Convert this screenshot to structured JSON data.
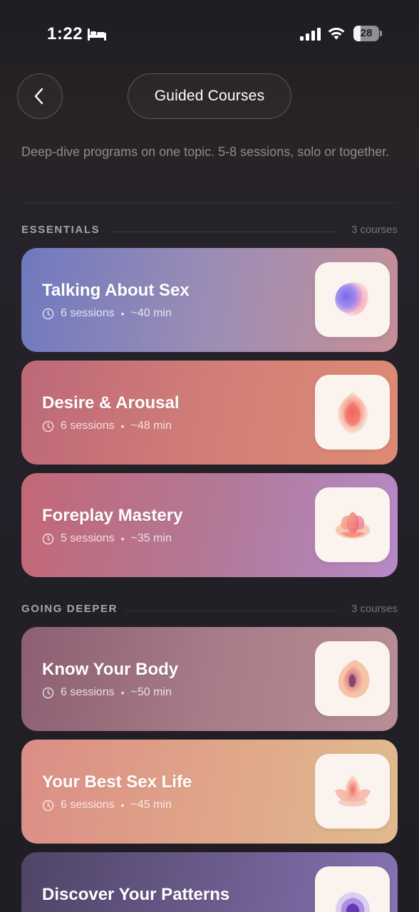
{
  "status_bar": {
    "time": "1:22",
    "battery": "28",
    "battery_level": 0.28,
    "icons": [
      "bed-icon",
      "cellular-signal-icon",
      "wifi-icon",
      "battery-icon"
    ]
  },
  "header": {
    "back_icon": "chevron-left-icon",
    "title": "Guided Courses"
  },
  "subtitle": "Deep-dive programs on one topic. 5-8 sessions, solo or together.",
  "sections": [
    {
      "title": "ESSENTIALS",
      "count": "3 courses",
      "courses": [
        {
          "title": "Talking About Sex",
          "sessions": "6 sessions",
          "duration": "~40 min",
          "icon": "blob-icon",
          "gradient": [
            "#6f79bf",
            "#9b8db5",
            "#c58f97"
          ]
        },
        {
          "title": "Desire & Arousal",
          "sessions": "6 sessions",
          "duration": "~48 min",
          "icon": "flame-icon",
          "gradient": [
            "#bd6878",
            "#d17e78",
            "#dd8b73"
          ]
        },
        {
          "title": "Foreplay Mastery",
          "sessions": "5 sessions",
          "duration": "~35 min",
          "icon": "flower-icon",
          "gradient": [
            "#c36777",
            "#b27895",
            "#b58ac6"
          ]
        }
      ]
    },
    {
      "title": "GOING DEEPER",
      "count": "3 courses",
      "courses": [
        {
          "title": "Know Your Body",
          "sessions": "6 sessions",
          "duration": "~50 min",
          "icon": "petal-icon",
          "gradient": [
            "#8c5f72",
            "#a77b87",
            "#b88e97"
          ]
        },
        {
          "title": "Your Best Sex Life",
          "sessions": "6 sessions",
          "duration": "~45 min",
          "icon": "lotus-icon",
          "gradient": [
            "#db8d86",
            "#e0a488",
            "#e1bb8f"
          ]
        },
        {
          "title": "Discover Your Patterns",
          "sessions": "",
          "duration": "",
          "icon": "ripple-icon",
          "gradient": [
            "#4f4466",
            "#6b5b8c",
            "#8673b2"
          ]
        }
      ]
    }
  ]
}
